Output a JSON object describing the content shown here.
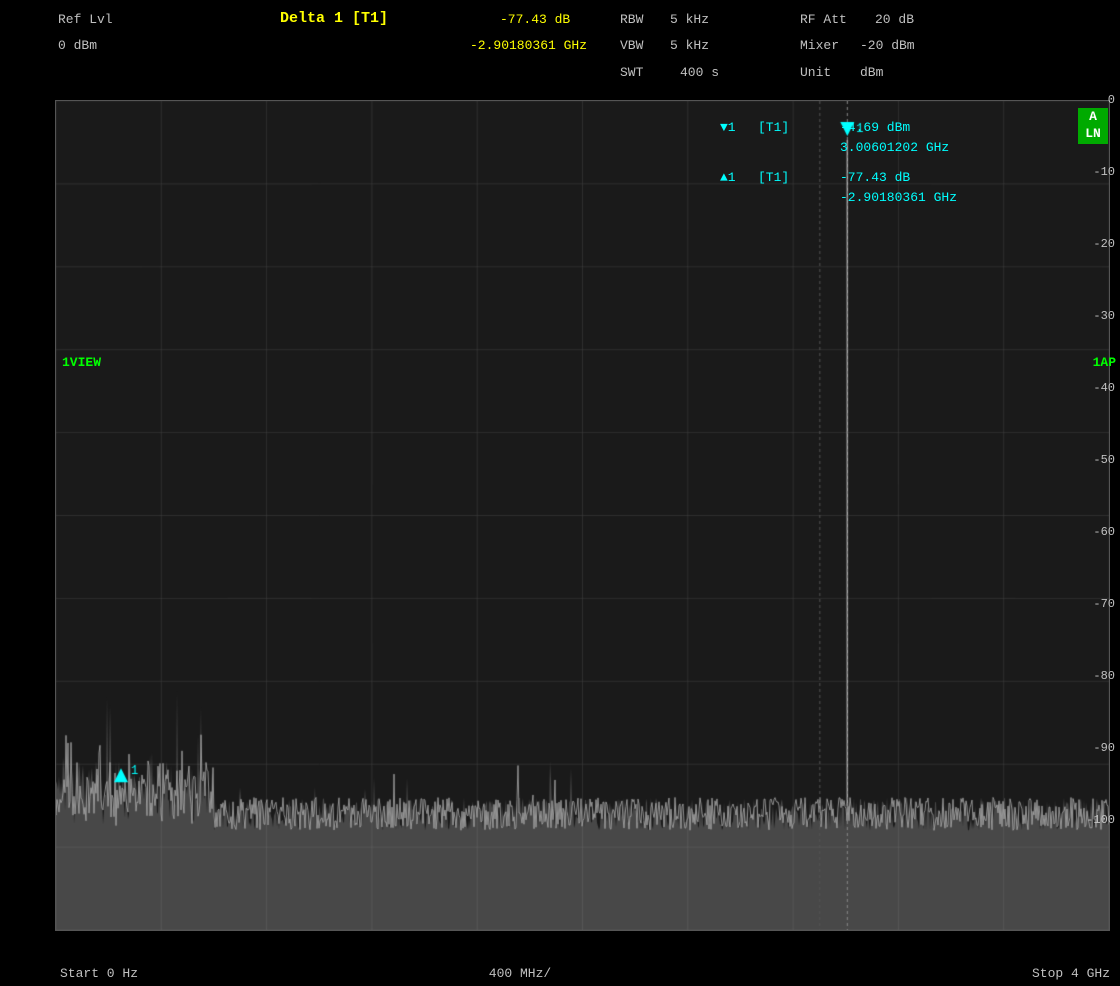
{
  "header": {
    "delta_label": "Delta 1 [T1]",
    "delta_value": "-77.43 dB",
    "delta_freq": "-2.90180361 GHz",
    "ref_lvl_label": "Ref Lvl",
    "ref_lvl_value": "0 dBm",
    "rbw_label": "RBW",
    "rbw_value": "5 kHz",
    "vbw_label": "VBW",
    "vbw_value": "5 kHz",
    "swt_label": "SWT",
    "swt_value": "400 s",
    "rfatt_label": "RF Att",
    "rfatt_value": "20 dB",
    "mixer_label": "Mixer",
    "mixer_value": "-20 dBm",
    "unit_label": "Unit",
    "unit_value": "dBm"
  },
  "markers": {
    "marker1_down_label": "▼1",
    "marker1_down_tag": "[T1]",
    "marker1_down_value": "-4.69 dBm",
    "marker1_down_freq": "3.00601202 GHz",
    "marker1_up_label": "▲1",
    "marker1_up_tag": "[T1]",
    "marker1_up_value": "-77.43 dB",
    "marker1_up_freq": "-2.90180361 GHz"
  },
  "chart": {
    "yaxis": [
      "0",
      "-10",
      "-20",
      "-30",
      "-40",
      "-50",
      "-60",
      "-70",
      "-80",
      "-90",
      "-100"
    ],
    "xaxis_start": "Start 0 Hz",
    "xaxis_mid": "400 MHz/",
    "xaxis_stop": "Stop 4 GHz"
  },
  "side_labels": {
    "left": "1VIEW",
    "right": "1AP"
  },
  "badge": {
    "line1": "A",
    "line2": "LN"
  },
  "marker_number": "1"
}
